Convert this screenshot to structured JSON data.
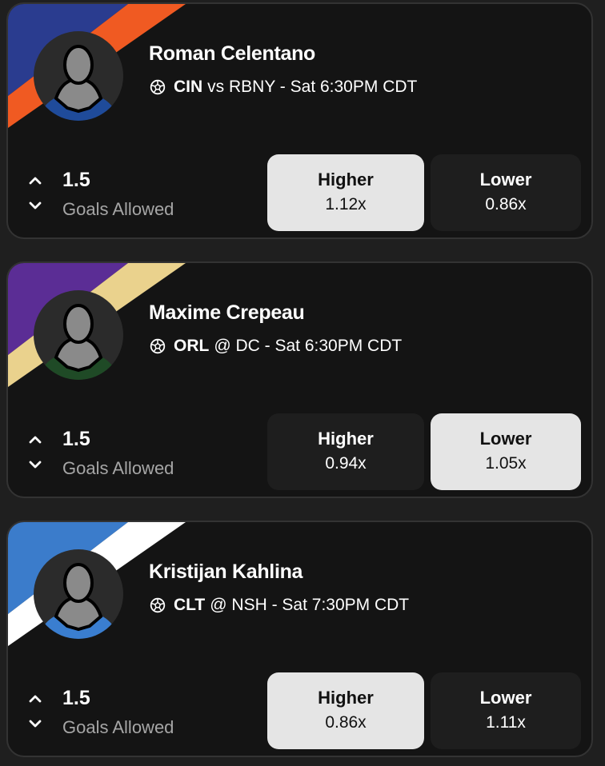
{
  "cards": [
    {
      "name": "Roman Celentano",
      "team": "CIN",
      "matchup_rest": "vs RBNY - Sat 6:30PM CDT",
      "line": "1.5",
      "stat": "Goals Allowed",
      "higher_label": "Higher",
      "higher_mult": "1.12x",
      "lower_label": "Lower",
      "lower_mult": "0.86x",
      "selected": "higher",
      "colors": {
        "primary": "#2a3c8f",
        "secondary": "#f05a22",
        "jersey": "#1f4b9a",
        "jersey_trim": "#f05a22"
      }
    },
    {
      "name": "Maxime Crepeau",
      "team": "ORL",
      "matchup_rest": "@ DC - Sat 6:30PM CDT",
      "line": "1.5",
      "stat": "Goals Allowed",
      "higher_label": "Higher",
      "higher_mult": "0.94x",
      "lower_label": "Lower",
      "lower_mult": "1.05x",
      "selected": "lower",
      "colors": {
        "primary": "#5b2d95",
        "secondary": "#ead28d",
        "jersey": "#1f4a26",
        "jersey_trim": "#e8c85a"
      }
    },
    {
      "name": "Kristijan Kahlina",
      "team": "CLT",
      "matchup_rest": "@ NSH - Sat 7:30PM CDT",
      "line": "1.5",
      "stat": "Goals Allowed",
      "higher_label": "Higher",
      "higher_mult": "0.86x",
      "lower_label": "Lower",
      "lower_mult": "1.11x",
      "selected": "higher",
      "colors": {
        "primary": "#3b7ccb",
        "secondary": "#ffffff",
        "jersey": "#3a7ed0",
        "jersey_trim": "#1a1a1a"
      }
    }
  ],
  "icons": {
    "sport": "soccer-ball-icon",
    "avatar": "player-silhouette-icon",
    "up": "chevron-up-icon",
    "down": "chevron-down-icon"
  }
}
